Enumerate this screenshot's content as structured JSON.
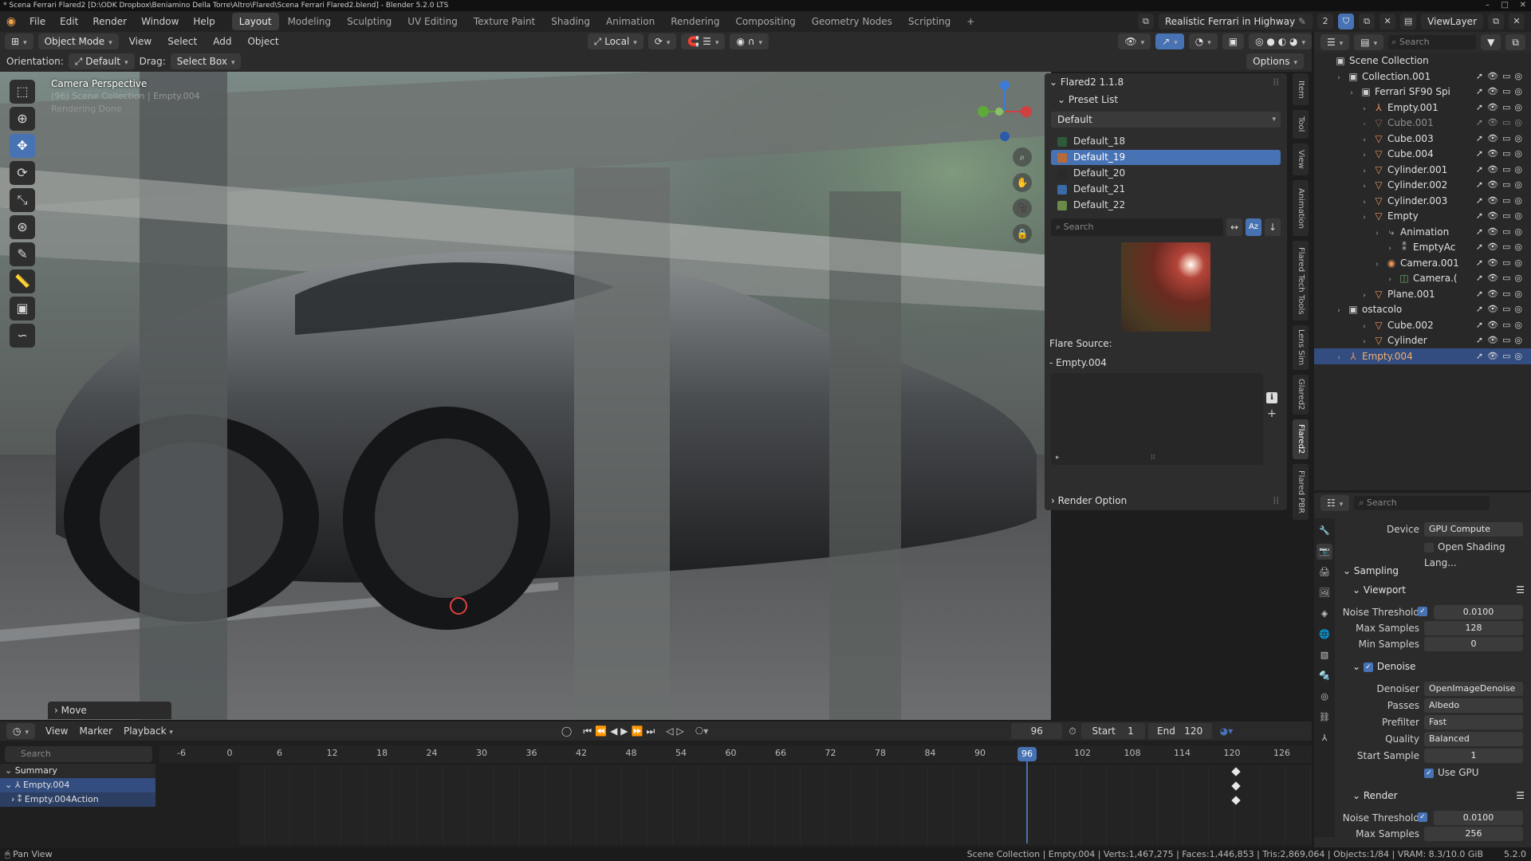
{
  "window": {
    "title": "* Scena Ferrari Flared2 [D:\\ODK Dropbox\\Beniamino Della Torre\\Altro\\Flared\\Scena Ferrari Flared2.blend] - Blender 5.2.0 LTS",
    "min": "–",
    "max": "□",
    "close": "✕"
  },
  "menu": [
    "File",
    "Edit",
    "Render",
    "Window",
    "Help"
  ],
  "workspaces": [
    "Layout",
    "Modeling",
    "Sculpting",
    "UV Editing",
    "Texture Paint",
    "Shading",
    "Animation",
    "Rendering",
    "Compositing",
    "Geometry Nodes",
    "Scripting",
    "+"
  ],
  "active_workspace": "Layout",
  "scene_name": "Realistic Ferrari in Highway",
  "scene_count": "2",
  "viewlayer": "ViewLayer",
  "viewport_header": {
    "mode": "Object Mode",
    "items": [
      "View",
      "Select",
      "Add",
      "Object"
    ],
    "transform": "Local"
  },
  "tool_settings": {
    "orientation_label": "Orientation:",
    "orientation_value": "Default",
    "drag_label": "Drag:",
    "drag_value": "Select Box",
    "options": "Options"
  },
  "viewport": {
    "camera_label": "Camera Perspective",
    "camera_sub": "(96) Scene Collection | Empty.004",
    "camera_sub2": "Rendering Done",
    "move_panel": "Move"
  },
  "flared": {
    "title": "Flared2 1.1.8",
    "preset_list_label": "Preset List",
    "preset_dropdown": "Default",
    "presets": [
      {
        "name": "Default_18",
        "color": "#2f5a3a"
      },
      {
        "name": "Default_19",
        "color": "#b86a3a"
      },
      {
        "name": "Default_20",
        "color": "#2a2a2a"
      },
      {
        "name": "Default_21",
        "color": "#3a6aa8"
      },
      {
        "name": "Default_22",
        "color": "#6a8a4a"
      }
    ],
    "selected_preset": "Default_19",
    "search_placeholder": "Search",
    "flare_source_label": "Flare Source:",
    "flare_source_item": "- Empty.004",
    "render_option": "Render Option"
  },
  "side_tabs": [
    "Item",
    "Tool",
    "View",
    "Animation",
    "Flared Tech Tools",
    "Lens Sim",
    "Glared2",
    "Flared2",
    "Flared PBR"
  ],
  "outliner": {
    "search_placeholder": "Search",
    "rows": [
      {
        "label": "Scene Collection",
        "indent": 0,
        "icon": "▣",
        "icon_color": "#d0d0d0",
        "sel": false
      },
      {
        "label": "Collection.001",
        "indent": 1,
        "icon": "▣",
        "icon_color": "#d0d0d0",
        "sel": false
      },
      {
        "label": "Ferrari SF90 Spi",
        "indent": 2,
        "icon": "▣",
        "icon_color": "#d0d0d0",
        "sel": false
      },
      {
        "label": "Empty.001",
        "indent": 3,
        "icon": "⅄",
        "icon_color": "#e8955a",
        "sel": false
      },
      {
        "label": "Cube.001",
        "indent": 3,
        "icon": "▽",
        "icon_color": "#e8955a",
        "sel": false,
        "dim": true
      },
      {
        "label": "Cube.003",
        "indent": 3,
        "icon": "▽",
        "icon_color": "#e8955a",
        "sel": false
      },
      {
        "label": "Cube.004",
        "indent": 3,
        "icon": "▽",
        "icon_color": "#e8955a",
        "sel": false
      },
      {
        "label": "Cylinder.001",
        "indent": 3,
        "icon": "▽",
        "icon_color": "#e8955a",
        "sel": false
      },
      {
        "label": "Cylinder.002",
        "indent": 3,
        "icon": "▽",
        "icon_color": "#e8955a",
        "sel": false
      },
      {
        "label": "Cylinder.003",
        "indent": 3,
        "icon": "▽",
        "icon_color": "#e8955a",
        "sel": false
      },
      {
        "label": "Empty",
        "indent": 3,
        "icon": "▽",
        "icon_color": "#e8955a",
        "sel": false
      },
      {
        "label": "Animation",
        "indent": 4,
        "icon": "⤷",
        "icon_color": "#bdbdbd",
        "sel": false
      },
      {
        "label": "EmptyAc",
        "indent": 5,
        "icon": "⁑",
        "icon_color": "#bdbdbd",
        "sel": false
      },
      {
        "label": "Camera.001",
        "indent": 4,
        "icon": "◉",
        "icon_color": "#e8955a",
        "sel": false
      },
      {
        "label": "Camera.(",
        "indent": 5,
        "icon": "◫",
        "icon_color": "#6aae6a",
        "sel": false
      },
      {
        "label": "Plane.001",
        "indent": 3,
        "icon": "▽",
        "icon_color": "#e8955a",
        "sel": false
      },
      {
        "label": "ostacolo",
        "indent": 1,
        "icon": "▣",
        "icon_color": "#d0d0d0",
        "sel": false
      },
      {
        "label": "Cube.002",
        "indent": 3,
        "icon": "▽",
        "icon_color": "#e8955a",
        "sel": false
      },
      {
        "label": "Cylinder",
        "indent": 3,
        "icon": "▽",
        "icon_color": "#e8955a",
        "sel": false
      },
      {
        "label": "Empty.004",
        "indent": 1,
        "icon": "⅄",
        "icon_color": "#e8955a",
        "sel": true
      }
    ]
  },
  "properties": {
    "search_placeholder": "Search",
    "device_label": "Device",
    "device_value": "GPU Compute",
    "osl_label": "Open Shading Lang...",
    "sampling": "Sampling",
    "viewport": "Viewport",
    "noise_threshold_label": "Noise Threshold",
    "noise_threshold_value": "0.0100",
    "max_samples_label": "Max Samples",
    "max_samples_value": "128",
    "min_samples_label": "Min Samples",
    "min_samples_value": "0",
    "denoise": "Denoise",
    "denoiser_label": "Denoiser",
    "denoiser_value": "OpenImageDenoise",
    "passes_label": "Passes",
    "passes_value": "Albedo",
    "prefilter_label": "Prefilter",
    "prefilter_value": "Fast",
    "quality_label": "Quality",
    "quality_value": "Balanced",
    "start_sample_label": "Start Sample",
    "start_sample_value": "1",
    "use_gpu": "Use GPU",
    "render": "Render",
    "render_noise_label": "Noise Threshold",
    "render_noise_value": "0.0100",
    "render_max_label": "Max Samples",
    "render_max_value": "256"
  },
  "timeline": {
    "menus": [
      "View",
      "Marker",
      "Playback"
    ],
    "current_frame": "96",
    "start_label": "Start",
    "start_value": "1",
    "end_label": "End",
    "end_value": "120",
    "search_placeholder": "Search",
    "ticks": [
      "-6",
      "0",
      "6",
      "12",
      "18",
      "24",
      "30",
      "36",
      "42",
      "48",
      "54",
      "60",
      "66",
      "72",
      "78",
      "84",
      "90",
      "96",
      "102",
      "108",
      "114",
      "120",
      "126"
    ],
    "playhead": "96",
    "channels": [
      "Summary",
      "Empty.004",
      "Empty.004Action"
    ]
  },
  "statusbar": {
    "left": "Pan View",
    "right": "Scene Collection | Empty.004 | Verts:1,467,275 | Faces:1,446,853 | Tris:2,869,064 | Objects:1/84 | VRAM: 8.3/10.0 GiB",
    "version": "5.2.0"
  },
  "colors": {
    "accent": "#4772b3",
    "object_orange": "#e8955a"
  }
}
